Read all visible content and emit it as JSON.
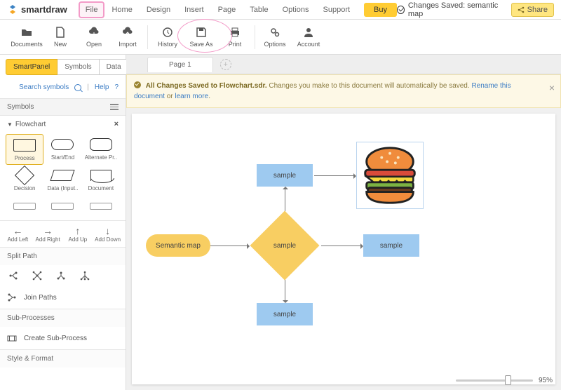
{
  "brand": "smartdraw",
  "menus": [
    "File",
    "Home",
    "Design",
    "Insert",
    "Page",
    "Table",
    "Options",
    "Support"
  ],
  "buy": "Buy",
  "saved_status": "Changes Saved: semantic map",
  "share": "Share",
  "toolbar": [
    {
      "id": "documents",
      "label": "Documents",
      "icon": "folder"
    },
    {
      "id": "new",
      "label": "New",
      "icon": "file"
    },
    {
      "id": "open",
      "label": "Open",
      "icon": "cloud-down"
    },
    {
      "id": "import",
      "label": "Import",
      "icon": "cloud-up"
    },
    {
      "id": "div"
    },
    {
      "id": "history",
      "label": "History",
      "icon": "history"
    },
    {
      "id": "saveas",
      "label": "Save As",
      "icon": "save",
      "circle": true
    },
    {
      "id": "print",
      "label": "Print",
      "icon": "print"
    },
    {
      "id": "div"
    },
    {
      "id": "options",
      "label": "Options",
      "icon": "gears"
    },
    {
      "id": "account",
      "label": "Account",
      "icon": "user"
    }
  ],
  "left_tabs": [
    "SmartPanel",
    "Symbols",
    "Data"
  ],
  "search_symbols": "Search symbols",
  "help": "Help",
  "symbols_header": "Symbols",
  "category": "Flowchart",
  "symbols": [
    {
      "label": "Process",
      "shape": "rect",
      "active": true
    },
    {
      "label": "Start/End",
      "shape": "round"
    },
    {
      "label": "Alternate Pr..",
      "shape": "alt"
    },
    {
      "label": "Decision",
      "shape": "diam"
    },
    {
      "label": "Data (Input..",
      "shape": "para"
    },
    {
      "label": "Document",
      "shape": "doc"
    }
  ],
  "mini_tools": [
    {
      "label": "Add Left",
      "arr": "←"
    },
    {
      "label": "Add Right",
      "arr": "→"
    },
    {
      "label": "Add Up",
      "arr": "↑"
    },
    {
      "label": "Add Down",
      "arr": "↓"
    }
  ],
  "split_path": "Split Path",
  "join_paths": "Join Paths",
  "sub_processes": "Sub-Processes",
  "create_sub": "Create Sub-Process",
  "style_format": "Style & Format",
  "page_tab": "Page 1",
  "notif_bold": "All Changes Saved to Flowchart.sdr.",
  "notif_text": "Changes you make to this document will automatically be saved.",
  "notif_link1": "Rename this document",
  "notif_or": "or",
  "notif_link2": "learn more",
  "nodes": {
    "start": "Semantic map",
    "top": "sample",
    "dec": "sample",
    "right": "sample",
    "bot": "sample"
  },
  "zoom": "95%"
}
